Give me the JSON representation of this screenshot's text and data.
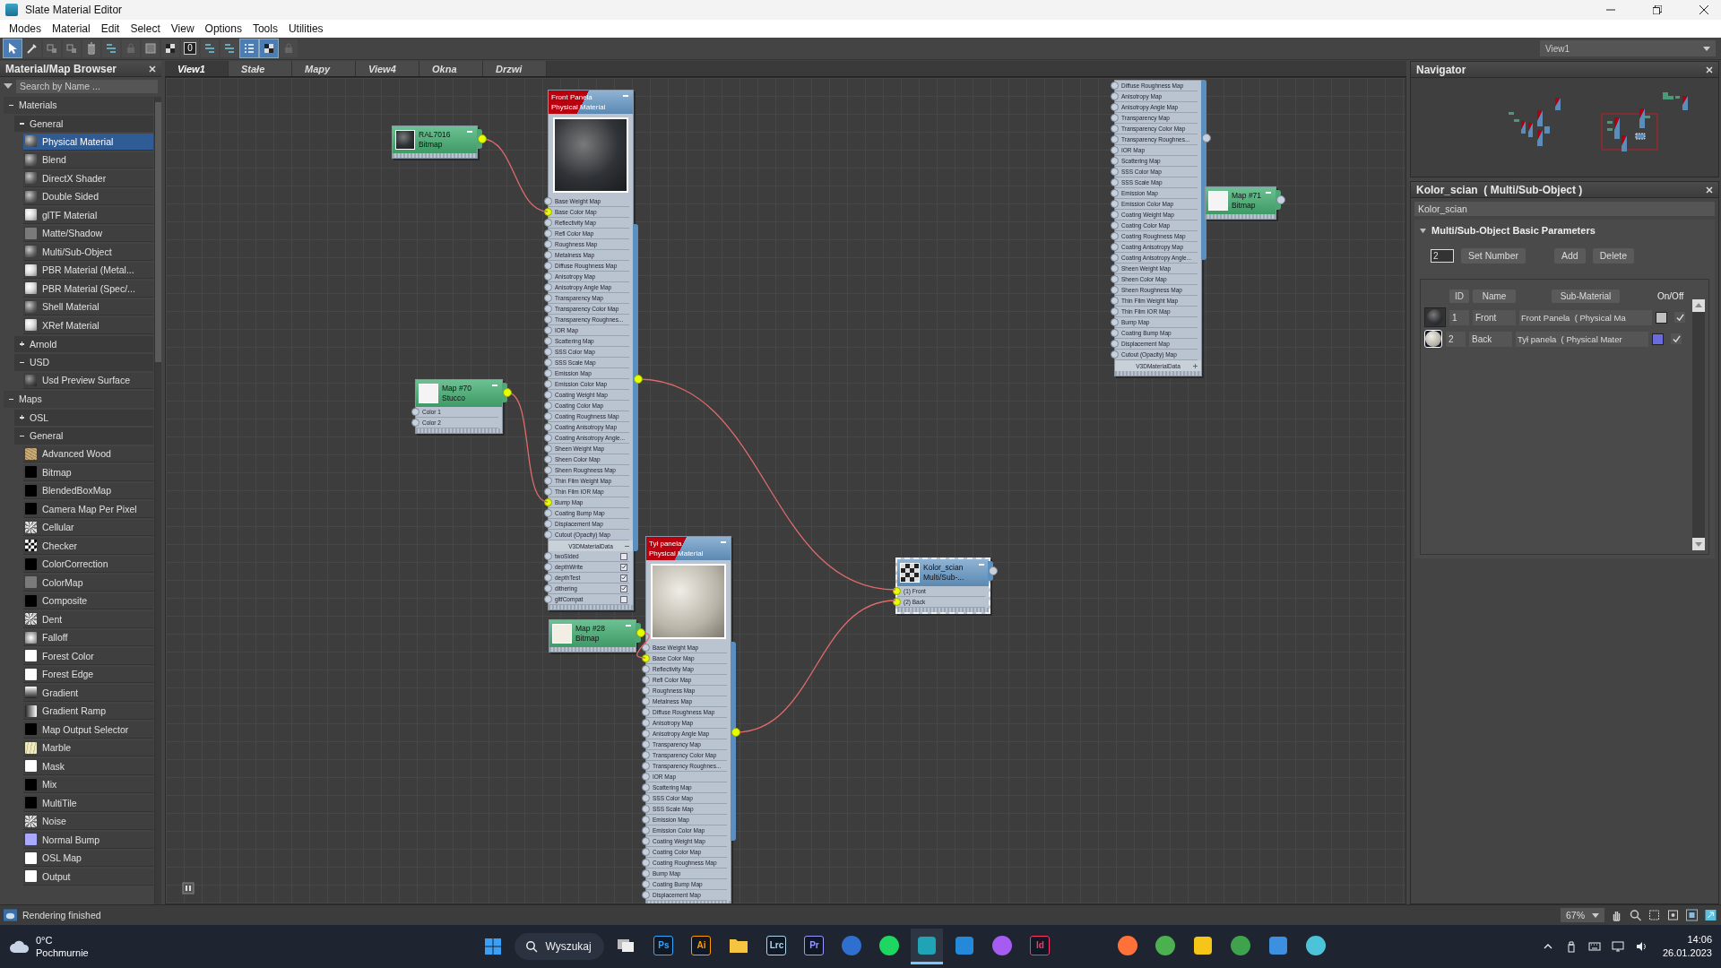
{
  "window": {
    "title": "Slate Material Editor"
  },
  "menu": [
    "Modes",
    "Material",
    "Edit",
    "Select",
    "View",
    "Options",
    "Tools",
    "Utilities"
  ],
  "toolbar": [
    {
      "kind": "pointer",
      "on": true
    },
    {
      "kind": "eyedropper",
      "on": false
    },
    {
      "kind": "assign",
      "on": false
    },
    {
      "kind": "assign",
      "on": false
    },
    {
      "kind": "delete",
      "on": false
    },
    {
      "kind": "layout",
      "on": false
    },
    {
      "kind": "lock",
      "on": false
    },
    {
      "kind": "square",
      "on": false
    },
    {
      "kind": "checker",
      "on": false
    },
    {
      "kind": "counter",
      "label": "0",
      "on": false
    },
    {
      "kind": "layout",
      "on": false
    },
    {
      "kind": "layout",
      "on": false
    },
    {
      "kind": "list",
      "on": true
    },
    {
      "kind": "checker",
      "on": true
    },
    {
      "kind": "lock",
      "on": false
    }
  ],
  "view_tabs": [
    {
      "label": "View1",
      "selected": true
    },
    {
      "label": "Stałe",
      "selected": false
    },
    {
      "label": "Mapy",
      "selected": false
    },
    {
      "label": "View4",
      "selected": false
    },
    {
      "label": "Okna",
      "selected": false
    },
    {
      "label": "Drzwi",
      "selected": false
    }
  ],
  "view_selector": "View1",
  "browser": {
    "title": "Material/Map Browser",
    "search": {
      "placeholder": "Search by Name ..."
    },
    "groups": [
      {
        "label": "Materials",
        "expanded": true,
        "children": [
          {
            "label": "General",
            "expanded": true,
            "items": [
              {
                "label": "Physical Material",
                "kind": "sphere",
                "selected": true
              },
              {
                "label": "Blend",
                "kind": "sphere",
                "selected": false
              },
              {
                "label": "DirectX Shader",
                "kind": "sphere",
                "selected": false
              },
              {
                "label": "Double Sided",
                "kind": "sphere",
                "selected": false
              },
              {
                "label": "glTF Material",
                "kind": "sphere-white",
                "selected": false
              },
              {
                "label": "Matte/Shadow",
                "kind": "gray",
                "selected": false
              },
              {
                "label": "Multi/Sub-Object",
                "kind": "sphere",
                "selected": false
              },
              {
                "label": "PBR Material (Metal...",
                "kind": "sphere-white",
                "selected": false
              },
              {
                "label": "PBR Material (Spec/...",
                "kind": "sphere-white",
                "selected": false
              },
              {
                "label": "Shell Material",
                "kind": "sphere",
                "selected": false
              },
              {
                "label": "XRef Material",
                "kind": "sphere-white",
                "selected": false
              }
            ]
          },
          {
            "label": "Arnold",
            "expanded": false
          },
          {
            "label": "USD",
            "expanded": true,
            "items": [
              {
                "label": "Usd Preview Surface",
                "kind": "sphere-dark",
                "selected": false
              }
            ]
          }
        ]
      },
      {
        "label": "Maps",
        "expanded": true,
        "children": [
          {
            "label": "OSL",
            "expanded": false
          },
          {
            "label": "General",
            "expanded": true,
            "items": [
              {
                "label": "Advanced Wood",
                "kind": "wood",
                "selected": false
              },
              {
                "label": "Bitmap",
                "kind": "black",
                "selected": false
              },
              {
                "label": "BlendedBoxMap",
                "kind": "black",
                "selected": false
              },
              {
                "label": "Camera Map Per Pixel",
                "kind": "black",
                "selected": false
              },
              {
                "label": "Cellular",
                "kind": "noise",
                "selected": false
              },
              {
                "label": "Checker",
                "kind": "checker",
                "selected": false
              },
              {
                "label": "ColorCorrection",
                "kind": "black",
                "selected": false
              },
              {
                "label": "ColorMap",
                "kind": "gray",
                "selected": false
              },
              {
                "label": "Composite",
                "kind": "black",
                "selected": false
              },
              {
                "label": "Dent",
                "kind": "noise",
                "selected": false
              },
              {
                "label": "Falloff",
                "kind": "falloff",
                "selected": false
              },
              {
                "label": "Forest Color",
                "kind": "white",
                "selected": false
              },
              {
                "label": "Forest Edge",
                "kind": "white",
                "selected": false
              },
              {
                "label": "Gradient",
                "kind": "gradient",
                "selected": false
              },
              {
                "label": "Gradient Ramp",
                "kind": "ramp",
                "selected": false
              },
              {
                "label": "Map Output Selector",
                "kind": "black",
                "selected": false
              },
              {
                "label": "Marble",
                "kind": "marble",
                "selected": false
              },
              {
                "label": "Mask",
                "kind": "white",
                "selected": false
              },
              {
                "label": "Mix",
                "kind": "black",
                "selected": false
              },
              {
                "label": "MultiTile",
                "kind": "black",
                "selected": false
              },
              {
                "label": "Noise",
                "kind": "noise",
                "selected": false
              },
              {
                "label": "Normal Bump",
                "kind": "lavender",
                "selected": false
              },
              {
                "label": "OSL Map",
                "kind": "white",
                "selected": false
              },
              {
                "label": "Output",
                "kind": "white",
                "selected": false
              }
            ]
          }
        ]
      }
    ]
  },
  "nodes": [
    {
      "kind": "map",
      "title": "RAL7016",
      "subtitle": "Bitmap",
      "selected": false,
      "output_connected": true
    },
    {
      "kind": "material",
      "title": "Front Panela",
      "subtitle": "Physical Material",
      "selected": false,
      "output_connected": true,
      "slots": [
        {
          "label": "Base Weight Map",
          "connected": false
        },
        {
          "label": "Base Color Map",
          "connected": true
        },
        {
          "label": "Reflectivity Map",
          "connected": false
        },
        {
          "label": "Refl Color Map",
          "connected": false
        },
        {
          "label": "Roughness Map",
          "connected": false
        },
        {
          "label": "Metalness Map",
          "connected": false
        },
        {
          "label": "Diffuse Roughness Map",
          "connected": false
        },
        {
          "label": "Anisotropy Map",
          "connected": false
        },
        {
          "label": "Anisotropy Angle Map",
          "connected": false
        },
        {
          "label": "Transparency Map",
          "connected": false
        },
        {
          "label": "Transparency Color Map",
          "connected": false
        },
        {
          "label": "Transparency Roughnes...",
          "connected": false
        },
        {
          "label": "IOR Map",
          "connected": false
        },
        {
          "label": "Scattering Map",
          "connected": false
        },
        {
          "label": "SSS Color Map",
          "connected": false
        },
        {
          "label": "SSS Scale Map",
          "connected": false
        },
        {
          "label": "Emission Map",
          "connected": false
        },
        {
          "label": "Emission Color Map",
          "connected": false
        },
        {
          "label": "Coating Weight Map",
          "connected": false
        },
        {
          "label": "Coating Color Map",
          "connected": false
        },
        {
          "label": "Coating Roughness Map",
          "connected": false
        },
        {
          "label": "Coating Anisotropy Map",
          "connected": false
        },
        {
          "label": "Coating Anisotropy Angle...",
          "connected": false
        },
        {
          "label": "Sheen Weight Map",
          "connected": false
        },
        {
          "label": "Sheen Color Map",
          "connected": false
        },
        {
          "label": "Sheen Roughness Map",
          "connected": false
        },
        {
          "label": "Thin Film Weight Map",
          "connected": false
        },
        {
          "label": "Thin Film IOR Map",
          "connected": false
        },
        {
          "label": "Bump Map",
          "connected": true
        },
        {
          "label": "Coating Bump Map",
          "connected": false
        },
        {
          "label": "Displacement Map",
          "connected": false
        },
        {
          "label": "Cutout (Opacity) Map",
          "connected": false
        }
      ],
      "section": {
        "label": "V3DMaterialData",
        "expanded": true
      },
      "params": [
        {
          "label": "twoSided",
          "checked": false
        },
        {
          "label": "depthWrite",
          "checked": true
        },
        {
          "label": "depthTest",
          "checked": true
        },
        {
          "label": "dithering",
          "checked": true
        },
        {
          "label": "gltfCompat",
          "checked": false
        }
      ]
    },
    {
      "kind": "map",
      "title": "Map #70",
      "subtitle": "Stucco",
      "selected": false,
      "output_connected": true,
      "slots": [
        {
          "label": "Color 1",
          "connected": false
        },
        {
          "label": "Color 2",
          "connected": false
        }
      ]
    },
    {
      "kind": "map",
      "title": "Map #28",
      "subtitle": "Bitmap",
      "selected": false,
      "output_connected": true
    },
    {
      "kind": "material",
      "title": "Tył panela",
      "subtitle": "Physical Material",
      "selected": false,
      "output_connected": true,
      "slots": [
        {
          "label": "Base Weight Map",
          "connected": false
        },
        {
          "label": "Base Color Map",
          "connected": true
        },
        {
          "label": "Reflectivity Map",
          "connected": false
        },
        {
          "label": "Refl Color Map",
          "connected": false
        },
        {
          "label": "Roughness Map",
          "connected": false
        },
        {
          "label": "Metalness Map",
          "connected": false
        },
        {
          "label": "Diffuse Roughness Map",
          "connected": false
        },
        {
          "label": "Anisotropy Map",
          "connected": false
        },
        {
          "label": "Anisotropy Angle Map",
          "connected": false
        },
        {
          "label": "Transparency Map",
          "connected": false
        },
        {
          "label": "Transparency Color Map",
          "connected": false
        },
        {
          "label": "Transparency Roughnes...",
          "connected": false
        },
        {
          "label": "IOR Map",
          "connected": false
        },
        {
          "label": "Scattering Map",
          "connected": false
        },
        {
          "label": "SSS Color Map",
          "connected": false
        },
        {
          "label": "SSS Scale Map",
          "connected": false
        },
        {
          "label": "Emission Map",
          "connected": false
        },
        {
          "label": "Emission Color Map",
          "connected": false
        },
        {
          "label": "Coating Weight Map",
          "connected": false
        },
        {
          "label": "Coating Color Map",
          "connected": false
        },
        {
          "label": "Coating Roughness Map",
          "connected": false
        },
        {
          "label": "Bump Map",
          "connected": false
        },
        {
          "label": "Coating Bump Map",
          "connected": false
        },
        {
          "label": "Displacement Map",
          "connected": false
        }
      ]
    },
    {
      "kind": "multi",
      "title": "Kolor_scian",
      "subtitle": "Multi/Sub-...",
      "selected": true,
      "output_connected": false,
      "slots": [
        {
          "label": "(1) Front",
          "connected": true
        },
        {
          "label": "(2) Back",
          "connected": true
        }
      ]
    },
    {
      "kind": "material",
      "selected": false,
      "output_connected": false,
      "slots": [
        {
          "label": "Diffuse Roughness Map",
          "connected": false
        },
        {
          "label": "Anisotropy Map",
          "connected": false
        },
        {
          "label": "Anisotropy Angle Map",
          "connected": false
        },
        {
          "label": "Transparency Map",
          "connected": false
        },
        {
          "label": "Transparency Color Map",
          "connected": false
        },
        {
          "label": "Transparency Roughnes...",
          "connected": false
        },
        {
          "label": "IOR Map",
          "connected": false
        },
        {
          "label": "Scattering Map",
          "connected": false
        },
        {
          "label": "SSS Color Map",
          "connected": false
        },
        {
          "label": "SSS Scale Map",
          "connected": false
        },
        {
          "label": "Emission Map",
          "connected": false
        },
        {
          "label": "Emission Color Map",
          "connected": false
        },
        {
          "label": "Coating Weight Map",
          "connected": false
        },
        {
          "label": "Coating Color Map",
          "connected": false
        },
        {
          "label": "Coating Roughness Map",
          "connected": false
        },
        {
          "label": "Coating Anisotropy Map",
          "connected": false
        },
        {
          "label": "Coating Anisotropy Angle...",
          "connected": false
        },
        {
          "label": "Sheen Weight Map",
          "connected": false
        },
        {
          "label": "Sheen Color Map",
          "connected": false
        },
        {
          "label": "Sheen Roughness Map",
          "connected": false
        },
        {
          "label": "Thin Film Weight Map",
          "connected": false
        },
        {
          "label": "Thin Film IOR Map",
          "connected": false
        },
        {
          "label": "Bump Map",
          "connected": false
        },
        {
          "label": "Coating Bump Map",
          "connected": false
        },
        {
          "label": "Displacement Map",
          "connected": false
        },
        {
          "label": "Cutout (Opacity) Map",
          "connected": false
        }
      ],
      "section": {
        "label": "V3DMaterialData",
        "expanded": false
      }
    },
    {
      "kind": "map",
      "title": "Map #71",
      "subtitle": "Bitmap",
      "selected": false,
      "output_connected": false
    }
  ],
  "navigator": {
    "title": "Navigator"
  },
  "parameters": {
    "title": "Kolor_scian  ( Multi/Sub-Object )",
    "name": "Kolor_scian",
    "rollout": {
      "title": "Multi/Sub-Object Basic Parameters",
      "expanded": true
    },
    "count": "2",
    "buttons": [
      "Set Number",
      "Add",
      "Delete"
    ],
    "columns": [
      "ID",
      "Name",
      "Sub-Material"
    ],
    "on_off_label": "On/Off",
    "rows": [
      {
        "id": "1",
        "name": "Front",
        "sub_material": "Front Panela  ( Physical Ma",
        "color": "#c0c0c0",
        "on": true
      },
      {
        "id": "2",
        "name": "Back",
        "sub_material": "Tył panela  ( Physical Mater",
        "color": "#6b6be0",
        "on": true
      }
    ]
  },
  "status_bar": {
    "message": "Rendering finished",
    "zoom": "67%"
  },
  "taskbar": {
    "weather": {
      "temperature": "0°C",
      "condition": "Pochmurnie"
    },
    "search_label": "Wyszukaj",
    "apps": [
      {
        "kind": "task-view",
        "active": false
      },
      {
        "kind": "letters",
        "label": "Ps",
        "color": "#31a8ff",
        "active": false
      },
      {
        "kind": "letters",
        "label": "Ai",
        "color": "#ff9a00",
        "active": false
      },
      {
        "kind": "folder",
        "color": "#f5c542",
        "active": false
      },
      {
        "kind": "letters",
        "label": "Lrc",
        "color": "#add5ec",
        "active": false
      },
      {
        "kind": "letters",
        "label": "Pr",
        "color": "#9999ff",
        "active": false
      },
      {
        "kind": "round",
        "color": "#2f6fd0",
        "active": false
      },
      {
        "kind": "round",
        "color": "#1ed760",
        "active": false
      },
      {
        "kind": "square",
        "color": "#1fa3b5",
        "active": true
      },
      {
        "kind": "square",
        "color": "#2489d8",
        "active": false
      },
      {
        "kind": "round",
        "color": "#a65cf0",
        "active": false
      },
      {
        "kind": "letters",
        "label": "Id",
        "color": "#ff3366",
        "active": false
      }
    ],
    "more_apps": [
      {
        "kind": "round",
        "color": "#ff7139",
        "active": false
      },
      {
        "kind": "round",
        "color": "#4caf50",
        "active": false
      },
      {
        "kind": "square",
        "color": "#f5c518",
        "active": false
      },
      {
        "kind": "round",
        "color": "#3fa34d",
        "active": false
      },
      {
        "kind": "square",
        "color": "#3d8fe0",
        "active": false
      },
      {
        "kind": "round",
        "color": "#4cc3d9",
        "active": false
      }
    ],
    "clock": {
      "time": "14:06",
      "date": "26.01.2023"
    }
  }
}
